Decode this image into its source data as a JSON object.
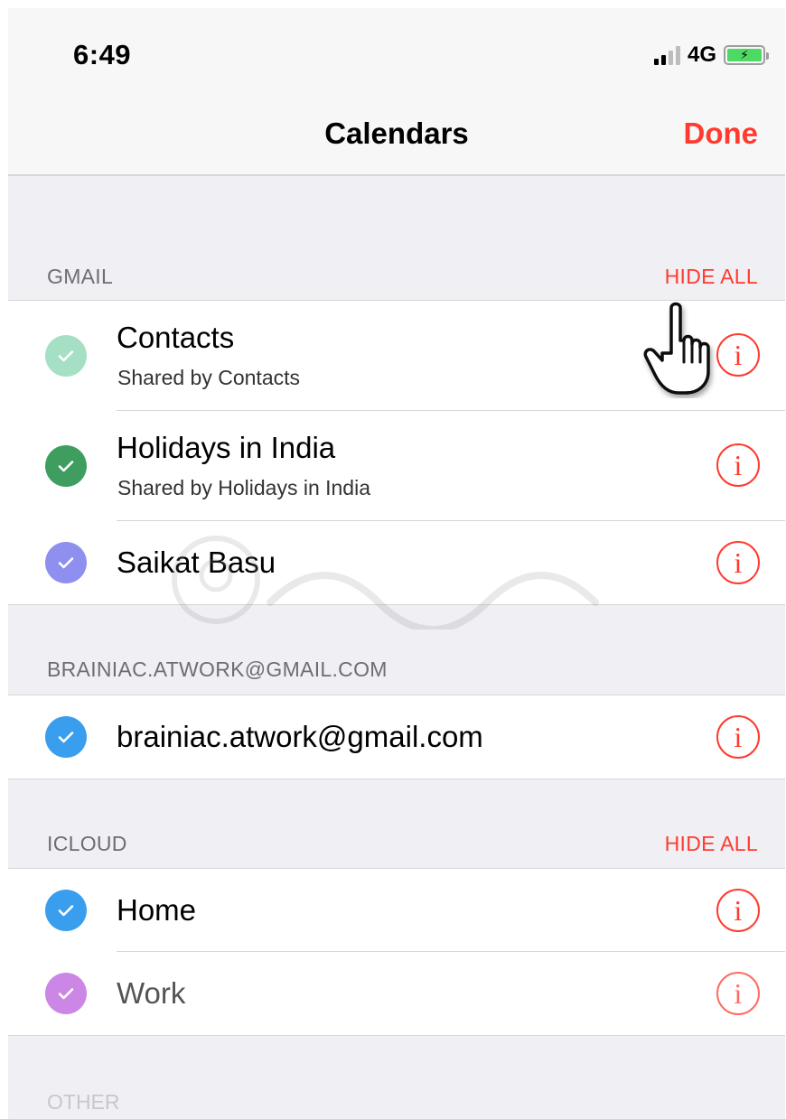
{
  "status_bar": {
    "time": "6:49",
    "network": "4G"
  },
  "nav": {
    "title": "Calendars",
    "done_label": "Done"
  },
  "sections": [
    {
      "header": "GMAIL",
      "hide_all": "HIDE ALL",
      "items": [
        {
          "title": "Contacts",
          "subtitle": "Shared by Contacts",
          "color": "#a6e0c4"
        },
        {
          "title": "Holidays in India",
          "subtitle": "Shared by Holidays in India",
          "color": "#3f9e5f"
        },
        {
          "title": "Saikat Basu",
          "subtitle": "",
          "color": "#8f8ff0"
        }
      ]
    },
    {
      "header": "BRAINIAC.ATWORK@GMAIL.COM",
      "hide_all": "",
      "items": [
        {
          "title": "brainiac.atwork@gmail.com",
          "subtitle": "",
          "color": "#3a9eee"
        }
      ]
    },
    {
      "header": "ICLOUD",
      "hide_all": "HIDE ALL",
      "items": [
        {
          "title": "Home",
          "subtitle": "",
          "color": "#3a9eee"
        },
        {
          "title": "Work",
          "subtitle": "",
          "color": "#cc86e6"
        }
      ]
    }
  ],
  "other_header": "OTHER",
  "info_glyph": "i",
  "accent_color": "#ff3b30",
  "icons": {
    "check": "checkmark-icon",
    "info": "info-icon",
    "cursor": "hand-pointer-icon"
  }
}
